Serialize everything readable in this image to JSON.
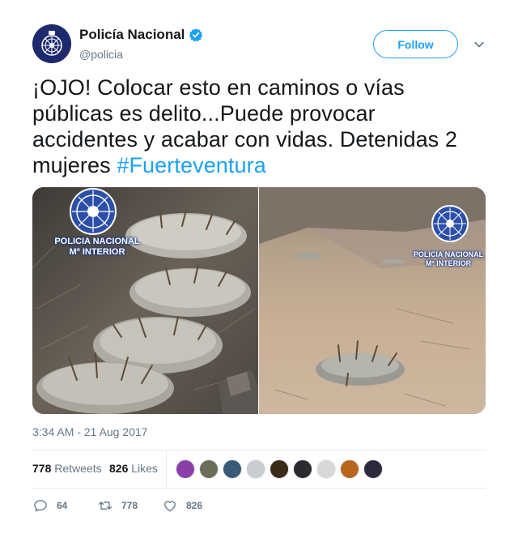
{
  "author": {
    "display_name": "Policía Nacional",
    "handle": "@policia",
    "verified": true,
    "avatar_icon": "police-badge-icon"
  },
  "follow_label": "Follow",
  "tweet": {
    "text": "¡OJO! Colocar esto en caminos o vías públicas es delito...Puede provocar accidentes y acabar con vidas. Detenidas 2 mujeres ",
    "hashtag": "#Fuerteventura"
  },
  "media": {
    "left": {
      "watermark": "POLICIA NACIONAL\nMº INTERIOR"
    },
    "right": {
      "watermark": "POLICIA NACIONAL\nMº INTERIOR"
    }
  },
  "timestamp": "3:34 AM - 21 Aug 2017",
  "stats": {
    "retweets_count": "778",
    "retweets_label": "Retweets",
    "likes_count": "826",
    "likes_label": "Likes"
  },
  "likers": [
    {
      "color": "#8a3fa8"
    },
    {
      "color": "#6b6f5a"
    },
    {
      "color": "#3a5a7a"
    },
    {
      "color": "#c9ccd1"
    },
    {
      "color": "#3a2a18"
    },
    {
      "color": "#2a2a30"
    },
    {
      "color": "#d8d8d8"
    },
    {
      "color": "#b8651e"
    },
    {
      "color": "#2c2a3a"
    }
  ],
  "actions": {
    "reply_count": "64",
    "retweet_count": "778",
    "like_count": "826"
  },
  "colors": {
    "accent": "#1da1f2",
    "text": "#14171a",
    "secondary": "#657786"
  }
}
